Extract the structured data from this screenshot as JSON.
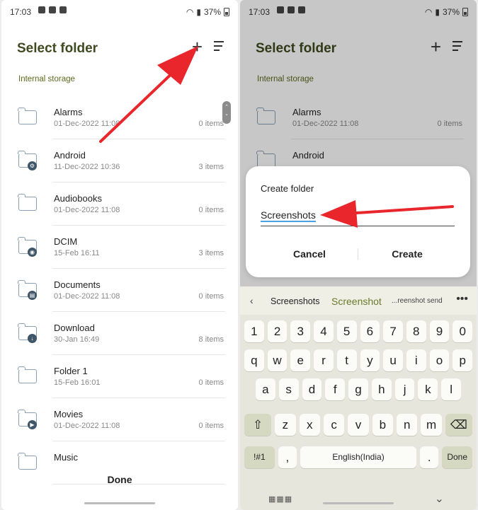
{
  "left_screen": {
    "status_time": "17:03",
    "battery": "37%",
    "title": "Select folder",
    "storage_label": "Internal storage",
    "folders": [
      {
        "name": "Alarms",
        "date": "01-Dec-2022 11:08",
        "count": "0 items",
        "icon": "folder-icon",
        "badge": ""
      },
      {
        "name": "Android",
        "date": "11-Dec-2022 10:36",
        "count": "3 items",
        "icon": "folder-icon",
        "badge": "⚙"
      },
      {
        "name": "Audiobooks",
        "date": "01-Dec-2022 11:08",
        "count": "0 items",
        "icon": "folder-icon",
        "badge": ""
      },
      {
        "name": "DCIM",
        "date": "15-Feb 16:11",
        "count": "3 items",
        "icon": "folder-icon",
        "badge": "◉"
      },
      {
        "name": "Documents",
        "date": "01-Dec-2022 11:08",
        "count": "0 items",
        "icon": "folder-icon",
        "badge": "▤"
      },
      {
        "name": "Download",
        "date": "30-Jan 16:49",
        "count": "8 items",
        "icon": "folder-icon",
        "badge": "↓"
      },
      {
        "name": "Folder 1",
        "date": "15-Feb 16:01",
        "count": "0 items",
        "icon": "folder-icon",
        "badge": ""
      },
      {
        "name": "Movies",
        "date": "01-Dec-2022 11:08",
        "count": "0 items",
        "icon": "folder-icon",
        "badge": "▶"
      },
      {
        "name": "Music",
        "date": "",
        "count": "",
        "icon": "folder-icon",
        "badge": ""
      }
    ],
    "done_label": "Done"
  },
  "right_screen": {
    "status_time": "17:03",
    "battery": "37%",
    "title": "Select folder",
    "storage_label": "Internal storage",
    "folders": [
      {
        "name": "Alarms",
        "date": "01-Dec-2022 11:08",
        "count": "0 items"
      },
      {
        "name": "Android",
        "date": "",
        "count": ""
      }
    ],
    "dialog": {
      "title": "Create folder",
      "input_value": "Screenshots",
      "cancel_label": "Cancel",
      "create_label": "Create"
    },
    "keyboard": {
      "suggestions": [
        "Screenshots",
        "Screenshot",
        "...reenshot send"
      ],
      "number_row": [
        "1",
        "2",
        "3",
        "4",
        "5",
        "6",
        "7",
        "8",
        "9",
        "0"
      ],
      "row1": [
        "q",
        "w",
        "e",
        "r",
        "t",
        "y",
        "u",
        "i",
        "o",
        "p"
      ],
      "row2": [
        "a",
        "s",
        "d",
        "f",
        "g",
        "h",
        "j",
        "k",
        "l"
      ],
      "row3": [
        "z",
        "x",
        "c",
        "v",
        "b",
        "n",
        "m"
      ],
      "symbols_label": "!#1",
      "comma": ",",
      "space_label": "English(India)",
      "period": ".",
      "done_label": "Done"
    }
  },
  "colors": {
    "title": "#3e4a1f",
    "storage": "#5a6a1d",
    "arrow": "#e8262b"
  }
}
